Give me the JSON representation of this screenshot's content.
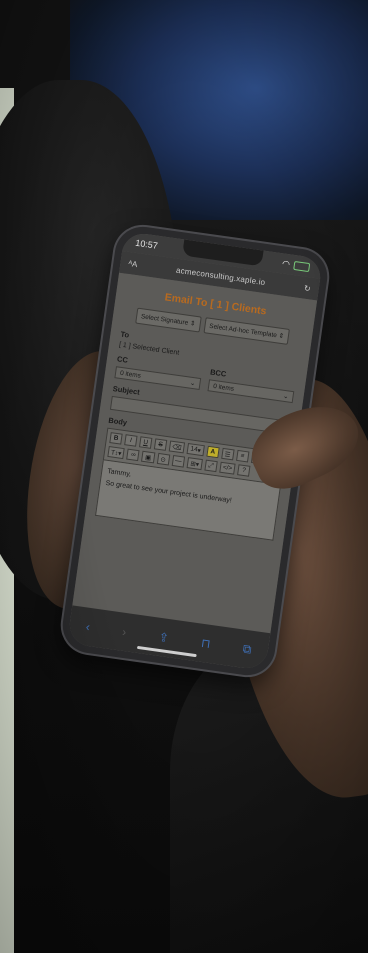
{
  "status": {
    "time": "10:57"
  },
  "browser": {
    "url": "acmeconsulting.xaple.io"
  },
  "email": {
    "title": "Email To [ 1 ] Clients",
    "select_signature": "Select Signature",
    "select_template": "Select Ad-hoc Template",
    "to_label": "To",
    "to_value": "[ 1 ] Selected Client",
    "cc_label": "CC",
    "cc_value": "0 items",
    "bcc_label": "BCC",
    "bcc_value": "0 items",
    "subject_label": "Subject",
    "body_label": "Body",
    "body_greeting": "Tammy,",
    "body_line": "So great to see your project is underway!"
  },
  "toolbar": {
    "bold": "B",
    "italic": "I",
    "underline": "U",
    "strike": "S",
    "font_size": "14",
    "highlight": "A",
    "help": "?"
  }
}
